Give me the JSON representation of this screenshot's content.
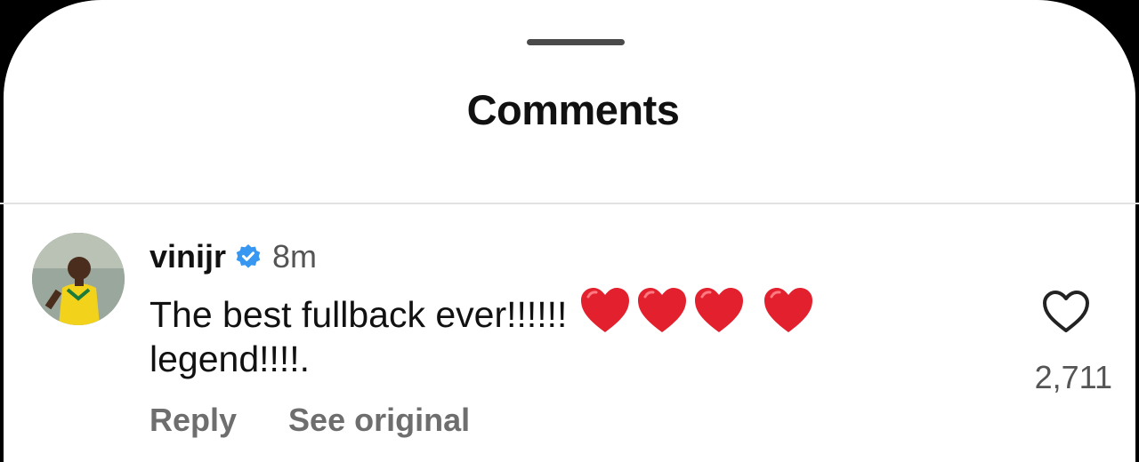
{
  "sheet": {
    "title": "Comments"
  },
  "comment": {
    "username": "vinijr",
    "verified": true,
    "timestamp": "8m",
    "text_line1": "The best fullback ever!!!!!!",
    "text_line2": "legend!!!!.",
    "emoji": [
      "red-heart",
      "red-heart",
      "red-heart",
      "red-heart"
    ],
    "actions": {
      "reply_label": "Reply",
      "see_original_label": "See original"
    },
    "likes": "2,711"
  },
  "colors": {
    "verified_badge": "#3897f0",
    "heart": "#e3202d",
    "secondary_text": "#6e6e6e"
  }
}
